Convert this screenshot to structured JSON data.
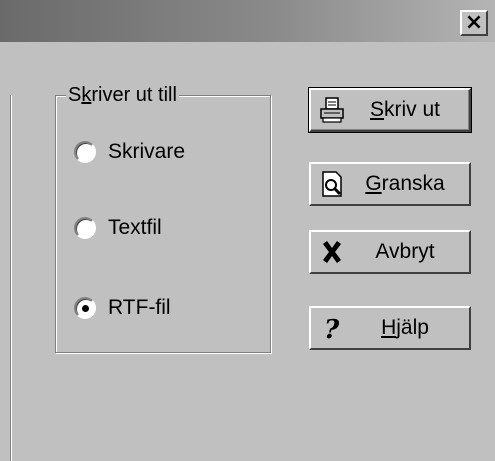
{
  "window": {
    "close_glyph": "×"
  },
  "group": {
    "legend_pre": "S",
    "legend_u": "k",
    "legend_post": "river ut till",
    "options": [
      {
        "label": "Skrivare",
        "selected": false
      },
      {
        "label": "Textfil",
        "selected": false
      },
      {
        "label": "RTF-fil",
        "selected": true
      }
    ]
  },
  "buttons": {
    "print": {
      "u": "S",
      "rest": "kriv ut",
      "icon": "printer-icon"
    },
    "preview": {
      "u": "G",
      "rest": "ranska",
      "icon": "print-preview-icon"
    },
    "cancel": {
      "label": "Avbryt",
      "icon": "cancel-x-icon"
    },
    "help": {
      "pre": "",
      "u": "H",
      "rest": "jälp",
      "icon": "help-question-icon"
    }
  }
}
